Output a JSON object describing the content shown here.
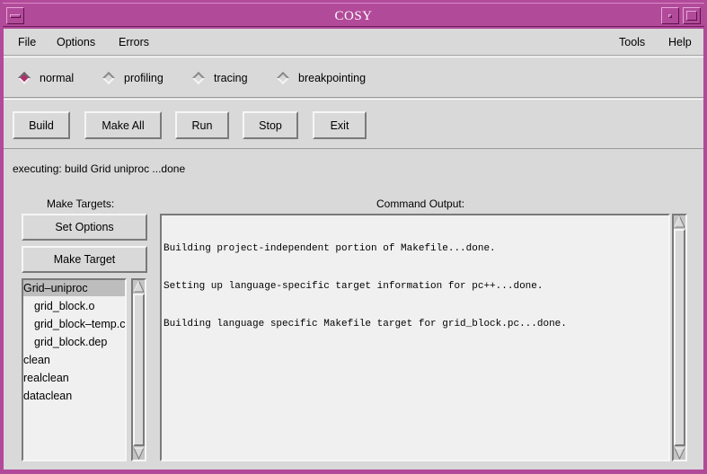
{
  "window": {
    "title": "COSY"
  },
  "menubar": {
    "file": "File",
    "options": "Options",
    "errors": "Errors",
    "tools": "Tools",
    "help": "Help"
  },
  "modes": {
    "selected": "normal",
    "items": [
      "normal",
      "profiling",
      "tracing",
      "breakpointing"
    ]
  },
  "toolbar": {
    "build": "Build",
    "make_all": "Make All",
    "run": "Run",
    "stop": "Stop",
    "exit": "Exit"
  },
  "status": {
    "text": "executing:  build Grid uniproc ...done"
  },
  "targets": {
    "title": "Make Targets:",
    "set_options": "Set Options",
    "make_target": "Make Target",
    "items": [
      "Grid–uniproc",
      "grid_block.o",
      "grid_block–temp.c",
      "grid_block.dep",
      "clean",
      "realclean",
      "dataclean"
    ],
    "selected": "Grid–uniproc"
  },
  "output": {
    "title": "Command Output:",
    "lines": [
      "Building project-independent portion of Makefile...done.",
      "Setting up language-specific target information for pc++...done.",
      "Building language specific Makefile target for grid_block.pc...done."
    ]
  },
  "colors": {
    "frame": "#b24a9a",
    "panel": "#d9d9d9",
    "radio_on": "#b0306f",
    "text_bg": "#f0f0f0"
  }
}
